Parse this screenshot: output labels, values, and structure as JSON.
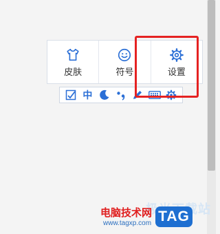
{
  "panel": {
    "buttons": [
      {
        "label": "皮肤",
        "icon": "tshirt-icon"
      },
      {
        "label": "符号",
        "icon": "smiley-icon"
      },
      {
        "label": "设置",
        "icon": "gear-icon"
      }
    ]
  },
  "toolbar": {
    "items": [
      {
        "icon": "checkbox-icon"
      },
      {
        "text": "中",
        "icon": "chinese-mode-icon"
      },
      {
        "icon": "crescent-moon-icon"
      },
      {
        "icon": "punctuation-icon"
      },
      {
        "icon": "pen-icon"
      },
      {
        "icon": "keyboard-icon"
      },
      {
        "icon": "gear-icon"
      }
    ]
  },
  "watermark": {
    "ghost_text": "极光下载站",
    "site_name": "电脑技术网",
    "url": "www.tagxp.com",
    "tag_text": "TAG"
  },
  "colors": {
    "accent_blue": "#2b6fd6",
    "highlight_red": "#e52222",
    "watermark_red": "#e02020"
  }
}
